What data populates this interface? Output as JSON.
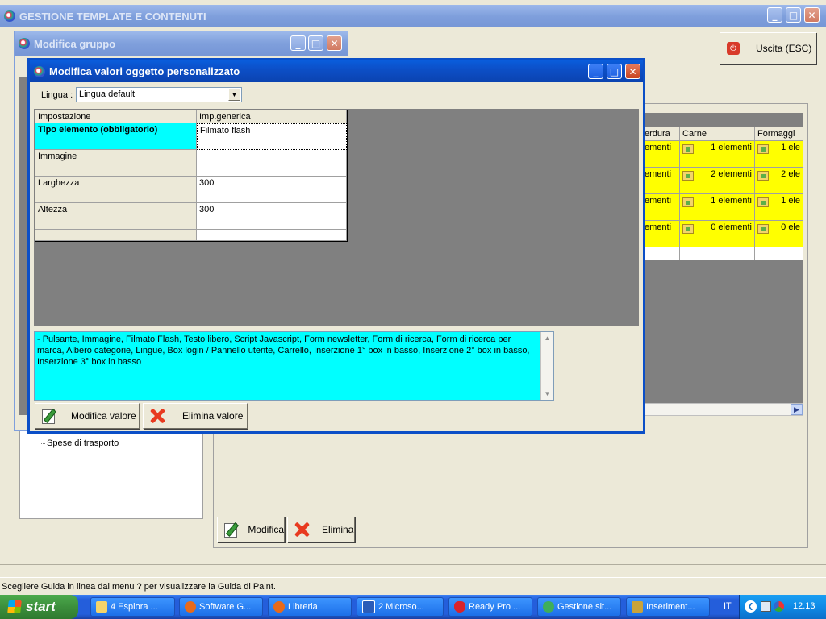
{
  "main_window": {
    "title": "GESTIONE TEMPLATE E CONTENUTI",
    "exit_button_label": "Uscita (ESC)"
  },
  "grid_behind": {
    "headers": [
      "erdura",
      "Carne",
      "Formaggi"
    ],
    "rows": [
      [
        "ementi",
        "1 elementi",
        "1 ele"
      ],
      [
        "ementi",
        "2 elementi",
        "2 ele"
      ],
      [
        "ementi",
        "1 elementi",
        "1 ele"
      ],
      [
        "ementi",
        "0 elementi",
        "0 ele"
      ]
    ]
  },
  "tree": {
    "item": "Spese di trasporto"
  },
  "main_actions": {
    "edit_label": "Modifica",
    "delete_label": "Elimina"
  },
  "group_window": {
    "title": "Modifica gruppo"
  },
  "custom_window": {
    "title": "Modifica valori oggetto personalizzato",
    "language_label": "Lingua :",
    "language_value": "Lingua default",
    "table_headers": [
      "Impostazione",
      "Imp.generica"
    ],
    "table_rows": [
      {
        "name": "Tipo elemento (obbligatorio)",
        "value": "Filmato flash"
      },
      {
        "name": "Immagine",
        "value": ""
      },
      {
        "name": "Larghezza",
        "value": "300"
      },
      {
        "name": "Altezza",
        "value": "300"
      }
    ],
    "description": "- Pulsante, Immagine, Filmato Flash, Testo libero, Script Javascript, Form newsletter, Form di ricerca, Form di ricerca per marca, Albero categorie, Lingue, Box login / Pannello utente, Carrello, Inserzione 1° box in basso, Inserzione 2° box in basso, Inserzione 3° box in basso",
    "edit_value_label": "Modifica valore",
    "delete_value_label": "Elimina valore"
  },
  "status_bar": {
    "text": "Scegliere Guida in linea dal menu ? per visualizzare la Guida di Paint."
  },
  "taskbar": {
    "start_label": "start",
    "tasks": [
      "4 Esplora ...",
      "Software G...",
      "Libreria",
      "2 Microso...",
      "Ready Pro ...",
      "Gestione sit...",
      "Inseriment..."
    ],
    "language": "IT",
    "clock": "12.13"
  },
  "colors": {
    "title_blue": "#0b4fc7",
    "highlight_cyan": "#00ffff",
    "row_yellow": "#ffff00",
    "close_red": "#c9431f"
  }
}
